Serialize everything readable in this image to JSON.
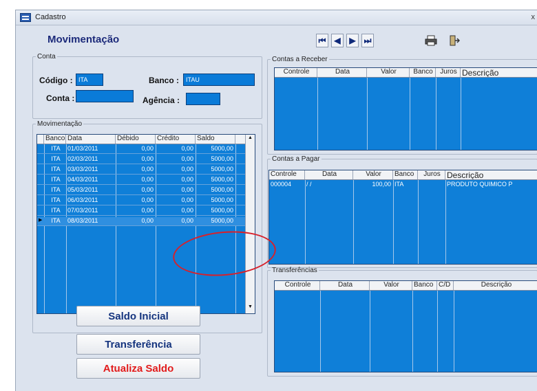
{
  "window": {
    "title": "Cadastro",
    "close_glyph": "x"
  },
  "header": {
    "title": "Movimentação"
  },
  "nav": {
    "first": "⏮",
    "prev": "◀",
    "next": "▶",
    "last": "⏭"
  },
  "toolbar": {
    "print_icon": "print-icon",
    "exit_icon": "exit-icon"
  },
  "conta": {
    "legend": "Conta",
    "codigo_label": "Código :",
    "codigo_value": "ITA",
    "banco_label": "Banco :",
    "banco_value": "ITAU",
    "conta_label": "Conta :",
    "conta_value": "",
    "agencia_label": "Agência :",
    "agencia_value": ""
  },
  "movimentacao": {
    "legend": "Movimentação",
    "columns": [
      "Banco",
      "Data",
      "Débido",
      "Crédito",
      "Saldo"
    ],
    "rows": [
      [
        "ITA",
        "01/03/2011",
        "0,00",
        "0,00",
        "5000,00"
      ],
      [
        "ITA",
        "02/03/2011",
        "0,00",
        "0,00",
        "5000,00"
      ],
      [
        "ITA",
        "03/03/2011",
        "0,00",
        "0,00",
        "5000,00"
      ],
      [
        "ITA",
        "04/03/2011",
        "0,00",
        "0,00",
        "5000,00"
      ],
      [
        "ITA",
        "05/03/2011",
        "0,00",
        "0,00",
        "5000,00"
      ],
      [
        "ITA",
        "06/03/2011",
        "0,00",
        "0,00",
        "5000,00"
      ],
      [
        "ITA",
        "07/03/2011",
        "0,00",
        "0,00",
        "5000,00"
      ],
      [
        "ITA",
        "08/03/2011",
        "0,00",
        "0,00",
        "5000,00"
      ]
    ]
  },
  "contas_receber": {
    "legend": "Contas a Receber",
    "columns": [
      "Controle",
      "Data",
      "Valor",
      "Banco",
      "Juros",
      "Descrição"
    ]
  },
  "contas_pagar": {
    "legend": "Contas a Pagar",
    "columns": [
      "Controle",
      "Data",
      "Valor",
      "Banco",
      "Juros",
      "Descrição"
    ],
    "rows": [
      [
        "000004",
        "/ /",
        "100,00",
        "ITA",
        "",
        "PRODUTO QUIMICO P"
      ]
    ]
  },
  "transferencias": {
    "legend": "Transferências",
    "columns": [
      "Controle",
      "Data",
      "Valor",
      "Banco",
      "C/D",
      "Descrição"
    ]
  },
  "buttons": {
    "saldo_inicial": "Saldo Inicial",
    "transferencia": "Transferência",
    "atualiza_saldo": "Atualiza Saldo"
  },
  "colors": {
    "grid_blue": "#0f7fd8",
    "header_navy": "#1c2a7a",
    "annotation_red": "#d8202a"
  }
}
